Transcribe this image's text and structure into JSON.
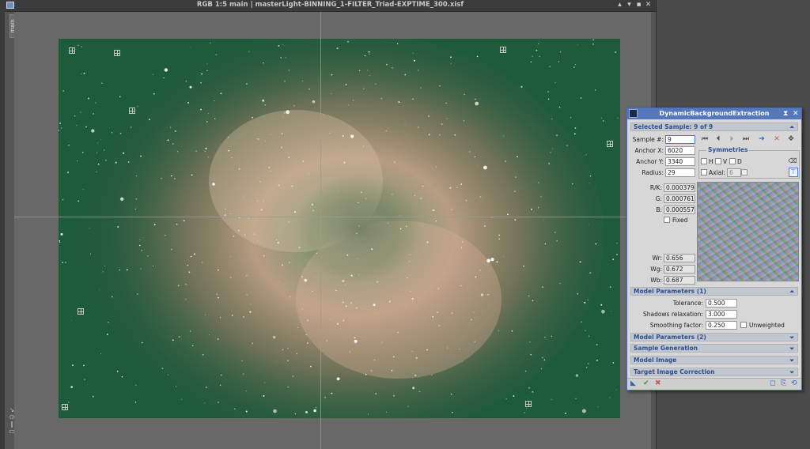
{
  "image_window": {
    "title": "RGB 1:5 main | masterLight-BINNING_1-FILTER_Triad-EXPTIME_300.xisf",
    "tab_label": "main",
    "buttons": [
      "shade",
      "minimize",
      "maximize",
      "close"
    ]
  },
  "dbe": {
    "title": "DynamicBackgroundExtraction",
    "selected_sample_header": "Selected Sample: 9 of 9",
    "sample_label": "Sample #:",
    "sample_value": "9",
    "anchor_x_label": "Anchor X:",
    "anchor_x": "6020",
    "anchor_y_label": "Anchor Y:",
    "anchor_y": "3340",
    "radius_label": "Radius:",
    "radius": "29",
    "symmetries_label": "Symmetries",
    "sym_h": "H",
    "sym_v": "V",
    "sym_d": "D",
    "axial_label": "Axial:",
    "axial_value": "6",
    "rk_label": "R/K:",
    "rk_value": "0.000379",
    "g_label": "G:",
    "g_value": "0.000761",
    "b_label": "B:",
    "b_value": "0.000557",
    "fixed_label": "Fixed",
    "wr_label": "Wr:",
    "wr_value": "0.656",
    "wg_label": "Wg:",
    "wg_value": "0.672",
    "wb_label": "Wb:",
    "wb_value": "0.687",
    "model_params1": "Model Parameters (1)",
    "tolerance_label": "Tolerance:",
    "tolerance_value": "0.500",
    "shadows_label": "Shadows relaxation:",
    "shadows_value": "3.000",
    "smoothing_label": "Smoothing factor:",
    "smoothing_value": "0.250",
    "unweighted_label": "Unweighted",
    "model_params2": "Model Parameters (2)",
    "sample_generation": "Sample Generation",
    "model_image": "Model Image",
    "target_correction": "Target Image Correction"
  },
  "colors": {
    "dialog_title": "#5578bd",
    "section_text": "#2d4f8f",
    "sky_green": "#1e5b3b",
    "nebula": "#c9a48a"
  }
}
